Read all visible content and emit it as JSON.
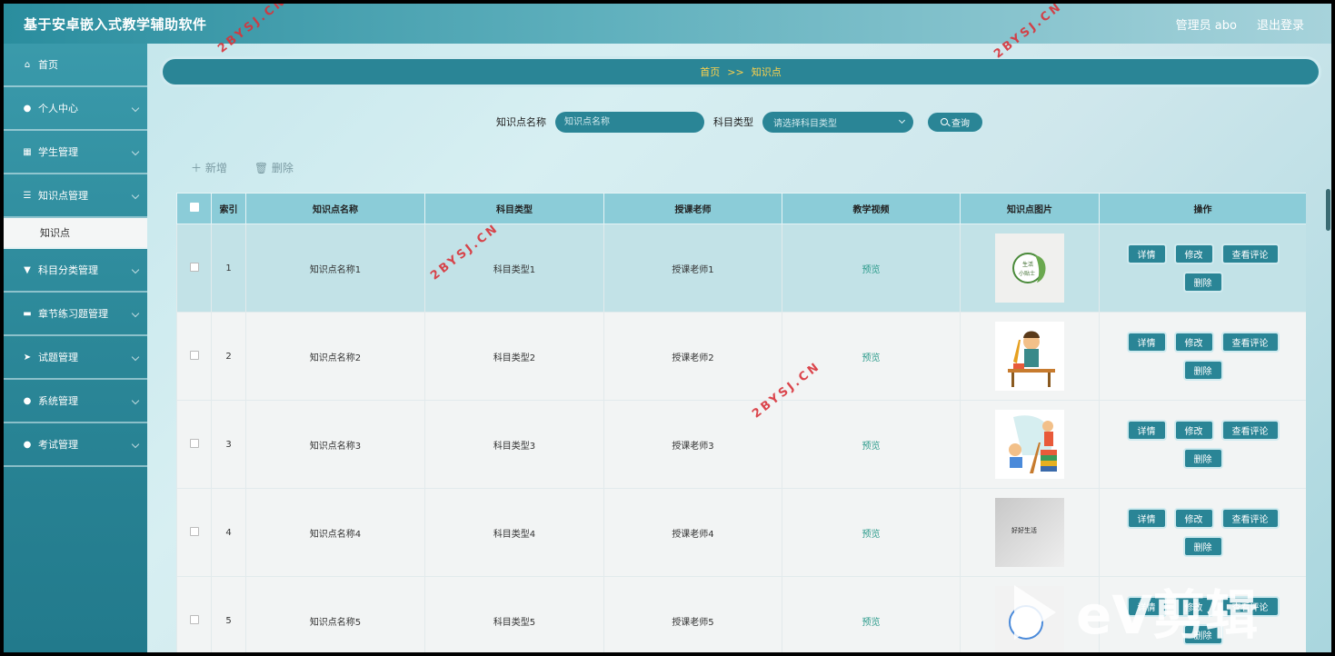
{
  "header": {
    "title": "基于安卓嵌入式教学辅助软件",
    "user": "管理员 abo",
    "logout": "退出登录"
  },
  "sidebar": {
    "items": [
      {
        "label": "首页",
        "icon": "home-icon"
      },
      {
        "label": "个人中心",
        "icon": "user-icon"
      },
      {
        "label": "学生管理",
        "icon": "grid-icon"
      },
      {
        "label": "知识点管理",
        "icon": "list-icon"
      },
      {
        "label": "知识点",
        "sub": true
      },
      {
        "label": "科目分类管理",
        "icon": "filter-icon"
      },
      {
        "label": "章节练习题管理",
        "icon": "briefcase-icon"
      },
      {
        "label": "试题管理",
        "icon": "send-icon"
      },
      {
        "label": "系统管理",
        "icon": "bulb-icon"
      },
      {
        "label": "考试管理",
        "icon": "user-icon"
      }
    ]
  },
  "breadcrumb": {
    "home": "首页",
    "sep": ">>",
    "current": "知识点"
  },
  "search": {
    "name_label": "知识点名称",
    "name_placeholder": "知识点名称",
    "type_label": "科目类型",
    "type_placeholder": "请选择科目类型",
    "button": "查询"
  },
  "actions": {
    "add": "新增",
    "delete": "删除"
  },
  "table": {
    "headers": [
      "索引",
      "知识点名称",
      "科目类型",
      "授课老师",
      "教学视频",
      "知识点图片",
      "操作"
    ],
    "rows": [
      {
        "index": "1",
        "name": "知识点名称1",
        "type": "科目类型1",
        "teacher": "授课老师1",
        "video": "预览",
        "img_text": "生活小贴士"
      },
      {
        "index": "2",
        "name": "知识点名称2",
        "type": "科目类型2",
        "teacher": "授课老师2",
        "video": "预览"
      },
      {
        "index": "3",
        "name": "知识点名称3",
        "type": "科目类型3",
        "teacher": "授课老师3",
        "video": "预览"
      },
      {
        "index": "4",
        "name": "知识点名称4",
        "type": "科目类型4",
        "teacher": "授课老师4",
        "video": "预览",
        "img_text": "好好生活"
      },
      {
        "index": "5",
        "name": "知识点名称5",
        "type": "科目类型5",
        "teacher": "授课老师5",
        "video": "预览"
      }
    ],
    "ops": {
      "detail": "详情",
      "edit": "修改",
      "comments": "查看评论",
      "delete": "删除"
    }
  },
  "watermark": "2BYSJ.CN",
  "ev_logo": "eV剪辑",
  "colors": {
    "primary": "#2a8596",
    "breadcrumb_text": "#ffd24a",
    "header_row": "#8bccd8",
    "highlight_row": "#c2e2e7"
  }
}
